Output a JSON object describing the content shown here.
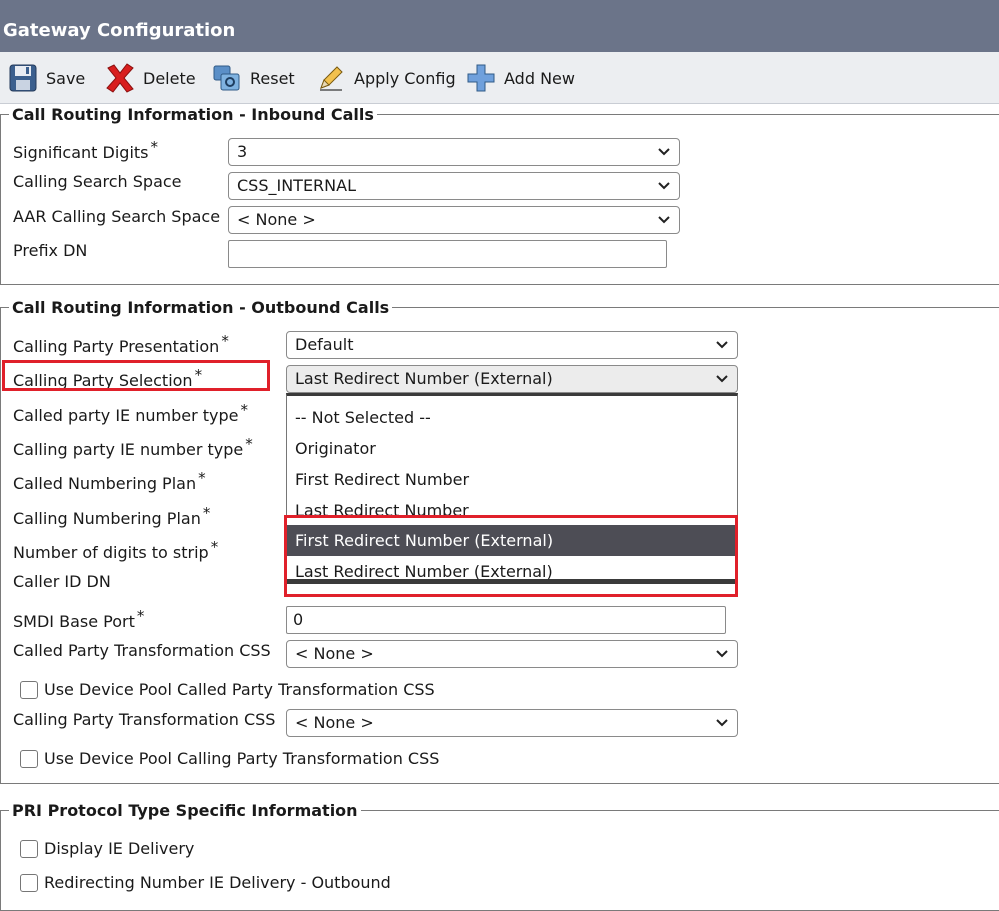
{
  "window": {
    "title": "Gateway Configuration"
  },
  "toolbar": {
    "save": "Save",
    "delete": "Delete",
    "reset": "Reset",
    "apply": "Apply Config",
    "add_new": "Add New"
  },
  "inbound": {
    "legend": "Call Routing Information - Inbound Calls",
    "significant_digits": {
      "label": "Significant Digits",
      "value": "3"
    },
    "css": {
      "label": "Calling Search Space",
      "value": "CSS_INTERNAL"
    },
    "aar_css": {
      "label": "AAR Calling Search Space",
      "value": "< None >"
    },
    "prefix_dn": {
      "label": "Prefix DN",
      "value": ""
    }
  },
  "outbound": {
    "legend": "Call Routing Information - Outbound Calls",
    "presentation": {
      "label": "Calling Party Presentation",
      "value": "Default"
    },
    "selection": {
      "label": "Calling Party Selection",
      "value": "Last Redirect Number (External)"
    },
    "called_ie": {
      "label": "Called party IE number type"
    },
    "calling_ie": {
      "label": "Calling party IE number type"
    },
    "called_plan": {
      "label": "Called Numbering Plan"
    },
    "calling_plan": {
      "label": "Calling Numbering Plan"
    },
    "digits_strip": {
      "label": "Number of digits to strip"
    },
    "caller_id_dn": {
      "label": "Caller ID DN"
    },
    "smdi_port": {
      "label": "SMDI Base Port",
      "value": "0"
    },
    "called_xform_css": {
      "label": "Called Party Transformation CSS",
      "value": "< None >"
    },
    "use_dp_called": {
      "label": "Use Device Pool Called Party Transformation CSS"
    },
    "calling_xform_css": {
      "label": "Calling Party Transformation CSS",
      "value": "< None >"
    },
    "use_dp_calling": {
      "label": "Use Device Pool Calling Party Transformation CSS"
    },
    "required_mark": "*"
  },
  "dropdown": {
    "options": [
      "-- Not Selected --",
      "Originator",
      "First Redirect Number",
      "Last Redirect Number",
      "First Redirect Number (External)",
      "Last Redirect Number (External)"
    ],
    "highlighted_index": 4
  },
  "pri": {
    "legend": "PRI Protocol Type Specific Information",
    "display_ie": {
      "label": "Display IE Delivery"
    },
    "redirecting_ie": {
      "label": "Redirecting Number IE Delivery - Outbound"
    }
  },
  "colors": {
    "title_bar": "#6b7489",
    "highlight": "#e0202a",
    "option_hover": "#4d4d55"
  }
}
